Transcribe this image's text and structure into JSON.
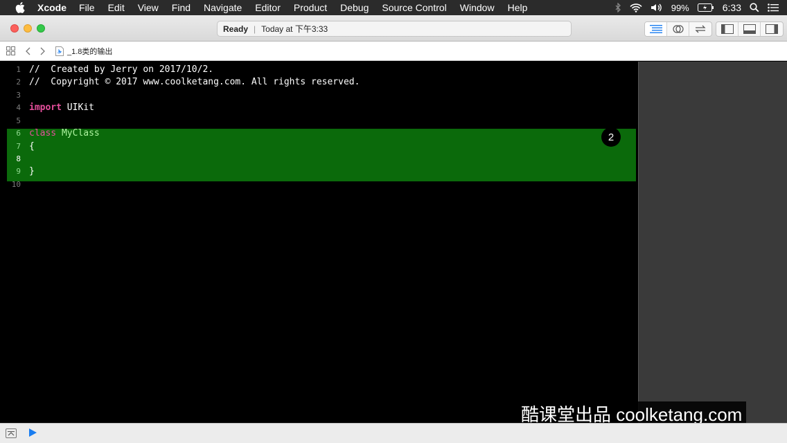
{
  "menubar": {
    "app_name": "Xcode",
    "items": [
      "File",
      "Edit",
      "View",
      "Find",
      "Navigate",
      "Editor",
      "Product",
      "Debug",
      "Source Control",
      "Window",
      "Help"
    ],
    "battery": "99%",
    "clock": "6:33"
  },
  "toolbar": {
    "activity_status": "Ready",
    "activity_detail": "Today at 下午3:33"
  },
  "jumpbar": {
    "file_name": "_1.8类的输出"
  },
  "editor": {
    "lines": [
      {
        "num": "1",
        "text": "//  Created by Jerry on 2017/10/2."
      },
      {
        "num": "2",
        "text": "//  Copyright © 2017 www.coolketang.com. All rights reserved."
      },
      {
        "num": "3",
        "text": ""
      },
      {
        "num": "4",
        "kw": "import",
        "rest": " UIKit"
      },
      {
        "num": "5",
        "text": ""
      },
      {
        "num": "6",
        "kw": "class",
        "rest": " MyClass"
      },
      {
        "num": "7",
        "text": "{"
      },
      {
        "num": "8",
        "text": ""
      },
      {
        "num": "9",
        "text": "}"
      },
      {
        "num": "10",
        "text": ""
      }
    ],
    "badge": "2"
  },
  "watermark": "酷课堂出品 coolketang.com",
  "colors": {
    "comment": "#3fbf3f",
    "keyword": "#e64f9c",
    "highlight": "#0b6a0b",
    "run_button": "#1a7df0"
  }
}
